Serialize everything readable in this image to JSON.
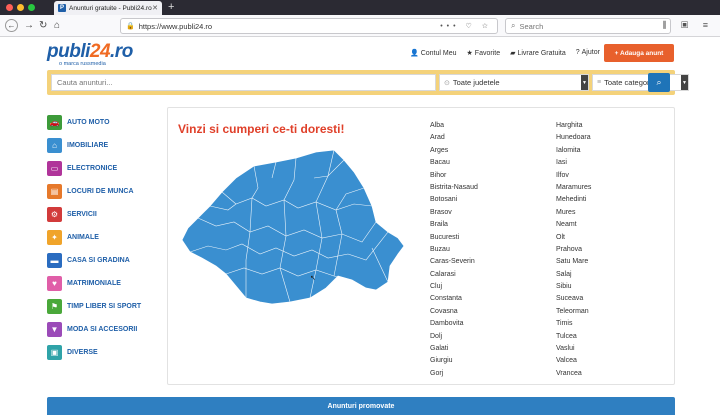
{
  "browser": {
    "tab_title": "Anunturi gratuite - Publi24.ro",
    "tab_favicon": "P",
    "url": "https://www.publi24.ro",
    "search_placeholder": "Search"
  },
  "header": {
    "logo_main": "publi",
    "logo_num": "24",
    "logo_tld": ".ro",
    "logo_sub": "o marca russmedia",
    "links": [
      {
        "label": "Contul Meu",
        "icon": "user-icon"
      },
      {
        "label": "Favorite",
        "icon": "star-icon"
      },
      {
        "label": "Livrare Gratuita",
        "icon": "truck-icon"
      },
      {
        "label": "Ajutor",
        "icon": "help-icon"
      }
    ],
    "add_button": "+ Adauga anunt"
  },
  "search": {
    "placeholder": "Cauta anunturi...",
    "county_select": "Toate judetele",
    "category_select": "Toate categoriile"
  },
  "categories": [
    {
      "label": "Auto Moto",
      "icon": "car-icon",
      "color": "#3d9b3a"
    },
    {
      "label": "Imobiliare",
      "icon": "house-icon",
      "color": "#3a8fd0"
    },
    {
      "label": "Electronice",
      "icon": "monitor-icon",
      "color": "#b0349a"
    },
    {
      "label": "Locuri de munca",
      "icon": "briefcase-icon",
      "color": "#e6792b"
    },
    {
      "label": "Servicii",
      "icon": "gears-icon",
      "color": "#d23b3b"
    },
    {
      "label": "Animale",
      "icon": "bird-icon",
      "color": "#f0a42a"
    },
    {
      "label": "Casa si gradina",
      "icon": "paint-roller-icon",
      "color": "#2a6cc0"
    },
    {
      "label": "Matrimoniale",
      "icon": "heart-icon",
      "color": "#e05ea8"
    },
    {
      "label": "Timp liber si sport",
      "icon": "flag-icon",
      "color": "#4aa83a"
    },
    {
      "label": "Moda si accesorii",
      "icon": "shirt-icon",
      "color": "#9b4bb8"
    },
    {
      "label": "Diverse",
      "icon": "box-icon",
      "color": "#2fa3a8"
    }
  ],
  "main": {
    "headline": "Vinzi si cumperi ce-ti doresti!",
    "map_color": "#3a8fd0",
    "counties_col1": [
      "Alba",
      "Arad",
      "Arges",
      "Bacau",
      "Bihor",
      "Bistrita-Nasaud",
      "Botosani",
      "Brasov",
      "Braila",
      "Bucuresti",
      "Buzau",
      "Caras-Severin",
      "Calarasi",
      "Cluj",
      "Constanta",
      "Covasna",
      "Dambovita",
      "Dolj",
      "Galati",
      "Giurgiu",
      "Gorj"
    ],
    "counties_col2": [
      "Harghita",
      "Hunedoara",
      "Ialomita",
      "Iasi",
      "Ilfov",
      "Maramures",
      "Mehedinti",
      "Mures",
      "Neamt",
      "Olt",
      "Prahova",
      "Satu Mare",
      "Salaj",
      "Sibiu",
      "Suceava",
      "Teleorman",
      "Timis",
      "Tulcea",
      "Vaslui",
      "Valcea",
      "Vrancea"
    ]
  },
  "promo_bar": "Anunturi promovate"
}
